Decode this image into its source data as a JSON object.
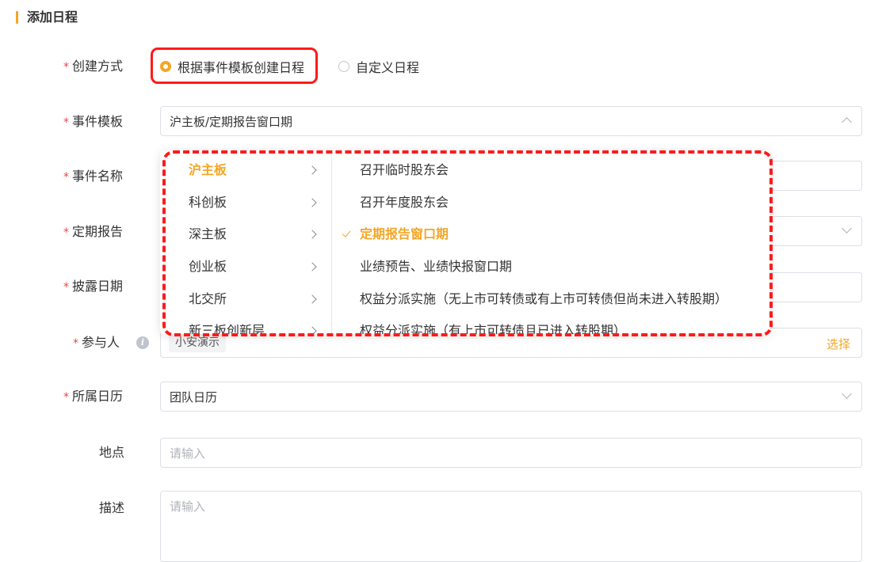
{
  "header": {
    "title": "添加日程"
  },
  "form": {
    "create_mode": {
      "label": "创建方式",
      "options": [
        "根据事件模板创建日程",
        "自定义日程"
      ],
      "selected_index": 0
    },
    "event_template": {
      "label": "事件模板",
      "value": "沪主板/定期报告窗口期"
    },
    "event_name": {
      "label": "事件名称"
    },
    "periodic_report": {
      "label": "定期报告"
    },
    "disclosure_date": {
      "label": "披露日期"
    },
    "participants": {
      "label": "参与人",
      "tag": "小安演示",
      "select_label": "选择"
    },
    "calendar": {
      "label": "所属日历",
      "value": "团队日历"
    },
    "location": {
      "label": "地点",
      "placeholder": "请输入"
    },
    "description": {
      "label": "描述",
      "placeholder": "请输入"
    }
  },
  "dropdown": {
    "boards": [
      "沪主板",
      "科创板",
      "深主板",
      "创业板",
      "北交所",
      "新三板创新层"
    ],
    "active_board_index": 0,
    "events": [
      "召开临时股东会",
      "召开年度股东会",
      "定期报告窗口期",
      "业绩预告、业绩快报窗口期",
      "权益分派实施（无上市可转债或有上市可转债但尚未进入转股期）",
      "权益分派实施（有上市可转债且已进入转股期）"
    ],
    "selected_event_index": 2
  },
  "colors": {
    "accent": "#f5a623",
    "required": "#e84747",
    "highlight": "#ff1a1a"
  }
}
